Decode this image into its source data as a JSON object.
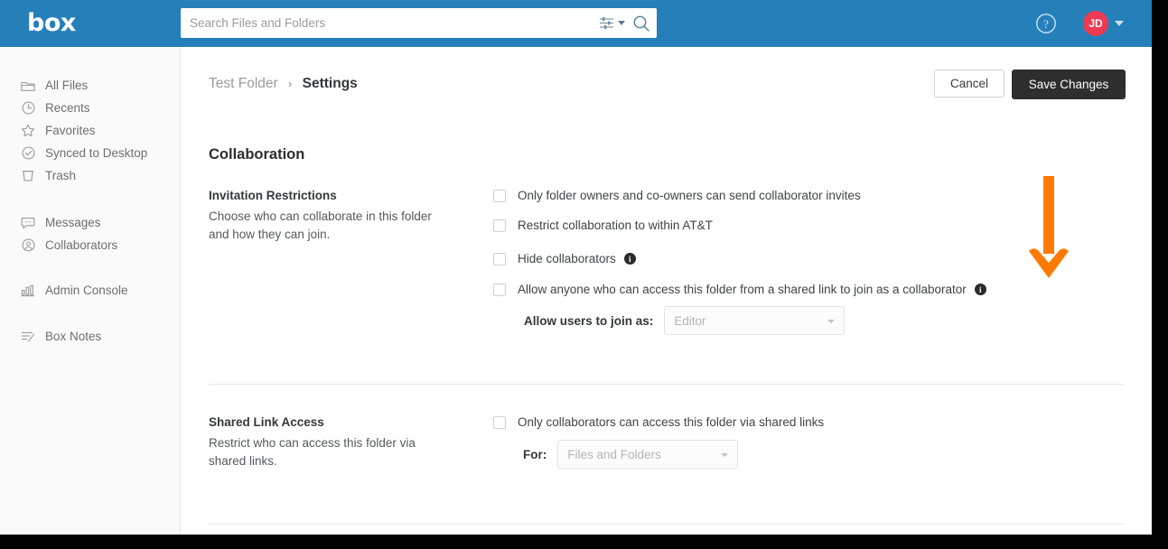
{
  "window": {
    "app_name": "box",
    "logo_text": "box"
  },
  "header": {
    "search": {
      "placeholder": "Search Files and Folders",
      "value": "",
      "filter_icon": "sliders-icon",
      "filter_caret_icon": "chevron-down-icon",
      "search_icon": "search-icon"
    },
    "help_icon": "help-circle-icon",
    "avatar": {
      "initials": "JD",
      "color": "#ed3a52",
      "caret_icon": "chevron-down-icon"
    }
  },
  "sidebar": {
    "groups": [
      {
        "items": [
          {
            "label": "All Files",
            "icon": "folder-icon"
          },
          {
            "label": "Recents",
            "icon": "clock-icon"
          },
          {
            "label": "Favorites",
            "icon": "star-icon"
          },
          {
            "label": "Synced to Desktop",
            "icon": "check-circle-icon"
          },
          {
            "label": "Trash",
            "icon": "trash-icon"
          }
        ]
      },
      {
        "items": [
          {
            "label": "Messages",
            "icon": "message-bubble-icon"
          },
          {
            "label": "Collaborators",
            "icon": "person-circle-icon"
          }
        ]
      },
      {
        "items": [
          {
            "label": "Admin Console",
            "icon": "bar-chart-icon"
          }
        ]
      },
      {
        "items": [
          {
            "label": "Box Notes",
            "icon": "notes-icon"
          }
        ]
      }
    ]
  },
  "main": {
    "breadcrumb": {
      "parent": "Test Folder",
      "separator": "›",
      "current": "Settings"
    },
    "actions": {
      "cancel_label": "Cancel",
      "save_label": "Save Changes",
      "save_bg": "#2e2e2e"
    },
    "section_title": "Collaboration",
    "invitation_restrictions": {
      "title": "Invitation Restrictions",
      "description": "Choose who can collaborate in this folder and how they can join.",
      "options": [
        {
          "label": "Only folder owners and co-owners can send collaborator invites",
          "checked": false,
          "has_info": false
        },
        {
          "label": "Restrict collaboration to within AT&T",
          "checked": false,
          "has_info": false
        },
        {
          "label": "Hide collaborators",
          "checked": false,
          "has_info": true
        },
        {
          "label": "Allow anyone who can access this folder from a shared link to join as a collaborator",
          "checked": false,
          "has_info": true
        }
      ],
      "join_as": {
        "caption": "Allow users to join as:",
        "value": "Editor",
        "disabled": true
      }
    },
    "shared_link_access": {
      "title": "Shared Link Access",
      "description": "Restrict who can access this folder via shared links.",
      "options": [
        {
          "label": "Only collaborators can access this folder via shared links",
          "checked": false,
          "has_info": false
        }
      ],
      "for_select": {
        "caption": "For:",
        "value": "Files and Folders",
        "disabled": true
      }
    }
  },
  "annotation": {
    "type": "arrow-down",
    "color": "#ff7a00"
  }
}
